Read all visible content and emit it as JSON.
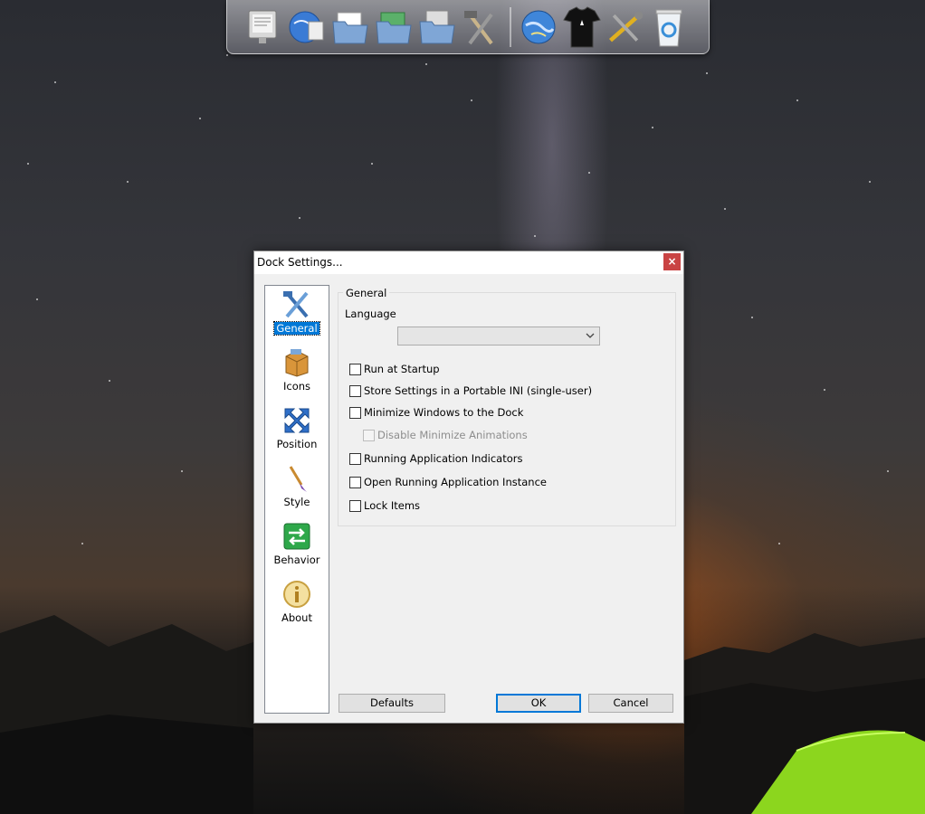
{
  "dock": {
    "items": [
      {
        "icon": "monitor-icon"
      },
      {
        "icon": "globe-network-icon"
      },
      {
        "icon": "documents-folder-icon"
      },
      {
        "icon": "music-folder-icon"
      },
      {
        "icon": "pictures-folder-icon"
      },
      {
        "icon": "hammer-wrench-icon"
      },
      {
        "icon": "world-globe-icon"
      },
      {
        "icon": "tshirt-icon"
      },
      {
        "icon": "tools-icon"
      },
      {
        "icon": "recycle-bin-icon"
      }
    ]
  },
  "dialog": {
    "title": "Dock Settings...",
    "close_glyph": "×",
    "nav": [
      {
        "label": "General",
        "icon": "hammer-wrench-icon",
        "selected": true
      },
      {
        "label": "Icons",
        "icon": "box-icon",
        "selected": false
      },
      {
        "label": "Position",
        "icon": "move-arrows-icon",
        "selected": false
      },
      {
        "label": "Style",
        "icon": "paintbrush-icon",
        "selected": false
      },
      {
        "label": "Behavior",
        "icon": "swap-arrows-icon",
        "selected": false
      },
      {
        "label": "About",
        "icon": "info-icon",
        "selected": false
      }
    ],
    "group_title": "General",
    "language_label": "Language",
    "language_value": "",
    "checkboxes": [
      {
        "label": "Run at Startup",
        "checked": false,
        "enabled": true
      },
      {
        "label": "Store Settings in a Portable INI (single-user)",
        "checked": false,
        "enabled": true
      },
      {
        "label": "Minimize Windows to the Dock",
        "checked": false,
        "enabled": true
      },
      {
        "label": "Disable Minimize Animations",
        "checked": false,
        "enabled": false
      },
      {
        "label": "Running Application Indicators",
        "checked": false,
        "enabled": true
      },
      {
        "label": "Open Running Application Instance",
        "checked": false,
        "enabled": true
      },
      {
        "label": "Lock Items",
        "checked": false,
        "enabled": true
      }
    ],
    "buttons": {
      "defaults": "Defaults",
      "ok": "OK",
      "cancel": "Cancel"
    }
  }
}
